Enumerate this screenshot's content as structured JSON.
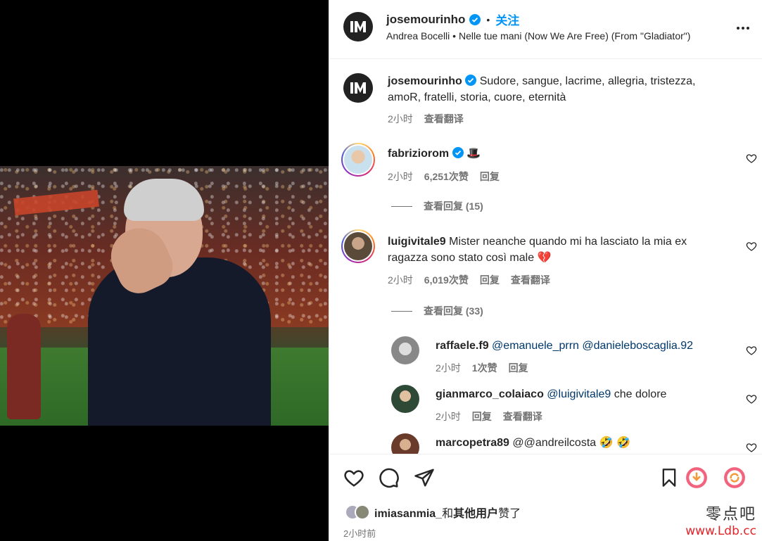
{
  "post": {
    "username": "josemourinho",
    "follow_label": "关注",
    "separator": "•",
    "audio": "Andrea Bocelli • Nelle tue mani (Now We Are Free) (From \"Gladiator\")"
  },
  "caption": {
    "username": "josemourinho",
    "text": "Sudore, sangue, lacrime, allegria, tristezza, amoR, fratelli, storia, cuore, eternità",
    "time": "2小时",
    "translate": "查看翻译"
  },
  "comments": [
    {
      "username": "fabriziorom",
      "text": "🎩",
      "time": "2小时",
      "likes": "6,251次赞",
      "reply": "回复",
      "view_replies": "查看回复 (15)"
    },
    {
      "username": "luigivitale9",
      "text": "Mister neanche quando mi ha lasciato la mia ex ragazza sono stato così male 💔",
      "time": "2小时",
      "likes": "6,019次赞",
      "reply": "回复",
      "translate": "查看翻译",
      "view_replies": "查看回复 (33)"
    }
  ],
  "replies": [
    {
      "username": "raffaele.f9",
      "mentions": "@emanuele_prrn @danieleboscaglia.92",
      "time": "2小时",
      "likes": "1次赞",
      "reply": "回复"
    },
    {
      "username": "gianmarco_colaiaco",
      "mention": "@luigivitale9",
      "text": " che dolore",
      "time": "2小时",
      "reply": "回复",
      "translate": "查看翻译"
    },
    {
      "username": "marcopetra89",
      "mention": "@@andreilcosta",
      "text": " 🤣 🤣"
    }
  ],
  "footer": {
    "liked_by_user": "imiasanmia_",
    "liked_by_mid": "和",
    "liked_by_others": "其他用户",
    "liked_by_tail": "赞了",
    "time_ago": "2小时前"
  },
  "watermark": {
    "line1": "零点吧",
    "line2": "www.Ldb.cc"
  },
  "colors": {
    "accent": "#0095f6",
    "text": "#262626",
    "muted": "#737373",
    "verified": "#0095f6"
  },
  "icons": [
    "verified-badge-icon",
    "more-options-icon",
    "heart-icon",
    "comment-icon",
    "share-icon",
    "bookmark-icon",
    "heart-outline-small-icon"
  ]
}
